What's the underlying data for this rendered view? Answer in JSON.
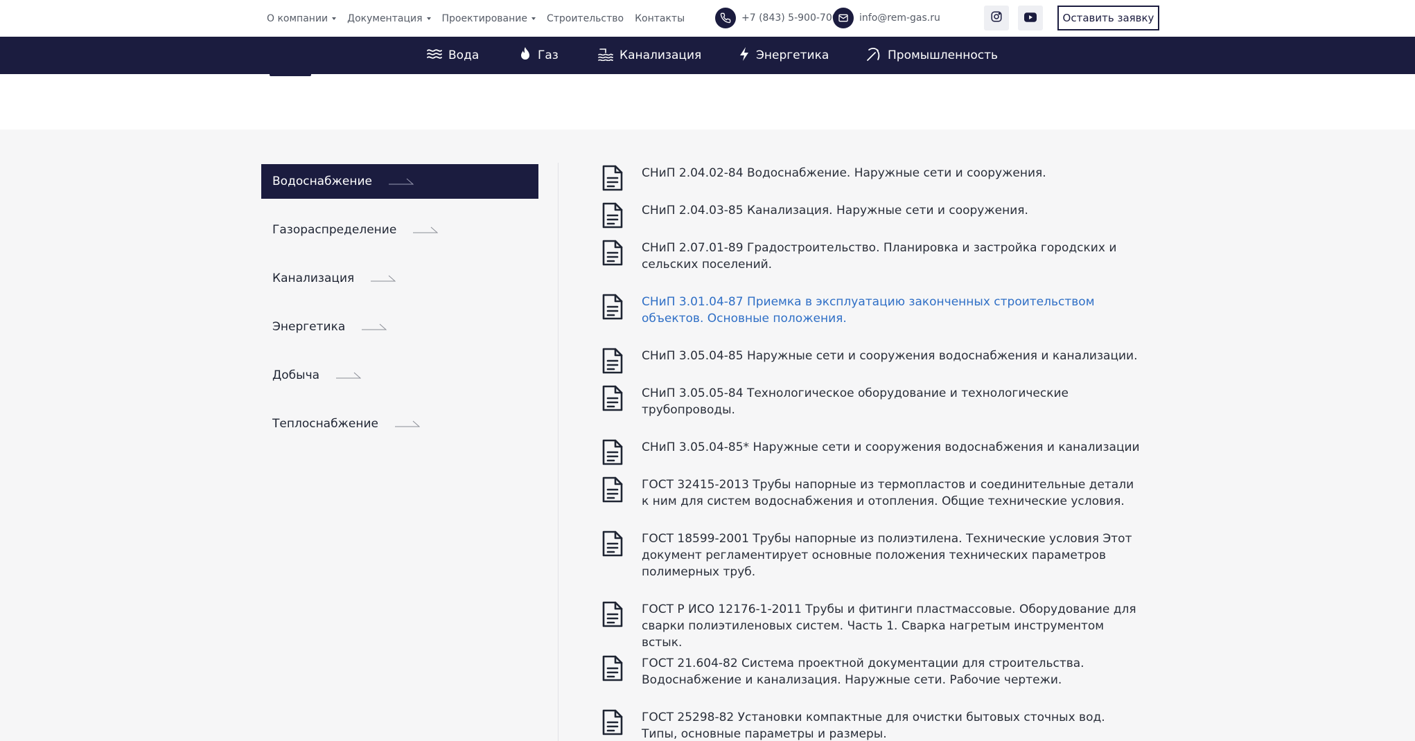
{
  "topnav": {
    "items": [
      {
        "label": "О компании",
        "dropdown": true
      },
      {
        "label": "Документация",
        "dropdown": true
      },
      {
        "label": "Проектирование",
        "dropdown": true
      },
      {
        "label": "Строительство",
        "dropdown": false
      },
      {
        "label": "Контакты",
        "dropdown": false
      }
    ],
    "phone": "+7 (843) 5-900-700",
    "email": "info@rem-gas.ru",
    "social_icons": [
      "instagram-icon",
      "youtube-icon"
    ],
    "cta_label": "Оставить заявку"
  },
  "categories": [
    {
      "label": "Вода",
      "icon": "water-waves-icon"
    },
    {
      "label": "Газ",
      "icon": "flame-icon"
    },
    {
      "label": "Канализация",
      "icon": "sewer-flow-icon"
    },
    {
      "label": "Энергетика",
      "icon": "lightning-icon"
    },
    {
      "label": "Промышленность",
      "icon": "pickaxe-icon"
    }
  ],
  "sidebar": {
    "items": [
      {
        "label": "Водоснабжение",
        "active": true
      },
      {
        "label": "Газораспределение",
        "active": false
      },
      {
        "label": "Канализация",
        "active": false
      },
      {
        "label": "Энергетика",
        "active": false
      },
      {
        "label": "Добыча",
        "active": false
      },
      {
        "label": "Теплоснабжение",
        "active": false
      }
    ]
  },
  "documents": [
    {
      "title": "СНиП 2.04.02-84 Водоснабжение. Наружные сети и сооружения.",
      "link": false
    },
    {
      "title": "СНиП 2.04.03-85 Канализация. Наружные сети и сооружения.",
      "link": false
    },
    {
      "title": "СНиП 2.07.01-89 Градостроительство. Планировка и застройка городских и сельских поселений.",
      "link": false
    },
    {
      "title": "СНиП 3.01.04-87 Приемка в эксплуатацию законченных строительством объектов. Основные положения.",
      "link": true
    },
    {
      "title": "СНиП 3.05.04-85 Наружные сети и сооружения водоснабжения и канализации.",
      "link": false
    },
    {
      "title": "СНиП 3.05.05-84 Технологическое оборудование и технологические трубопроводы.",
      "link": false
    },
    {
      "title": "СНиП 3.05.04-85* Наружные сети и сооружения водоснабжения и канализации",
      "link": false
    },
    {
      "title": "ГОСТ 32415-2013 Трубы напорные из термопластов и соединительные детали к ним для систем водоснабжения и отопления. Общие технические условия.",
      "link": false
    },
    {
      "title": "ГОСТ 18599-2001 Трубы напорные из полиэтилена. Технические условия Этот документ регламентирует основные положения технических параметров полимерных труб.",
      "link": false
    },
    {
      "title": "ГОСТ Р ИСО 12176-1-2011 Трубы и фитинги пластмассовые. Оборудование для сварки полиэтиленовых систем. Часть 1. Сварка нагретым инструментом встык.",
      "link": false
    },
    {
      "title": "ГОСТ 21.604-82 Система проектной документации для строительства. Водоснабжение и канализация. Наружные сети. Рабочие чертежи.",
      "link": false
    },
    {
      "title": "ГОСТ 25298-82 Установки компактные для очистки бытовых сточных вод. Типы, основные параметры и размеры.",
      "link": false
    }
  ],
  "colors": {
    "brand_dark": "#1b1c3f",
    "link": "#2f6fc6",
    "content_bg": "#f6f6f7"
  }
}
